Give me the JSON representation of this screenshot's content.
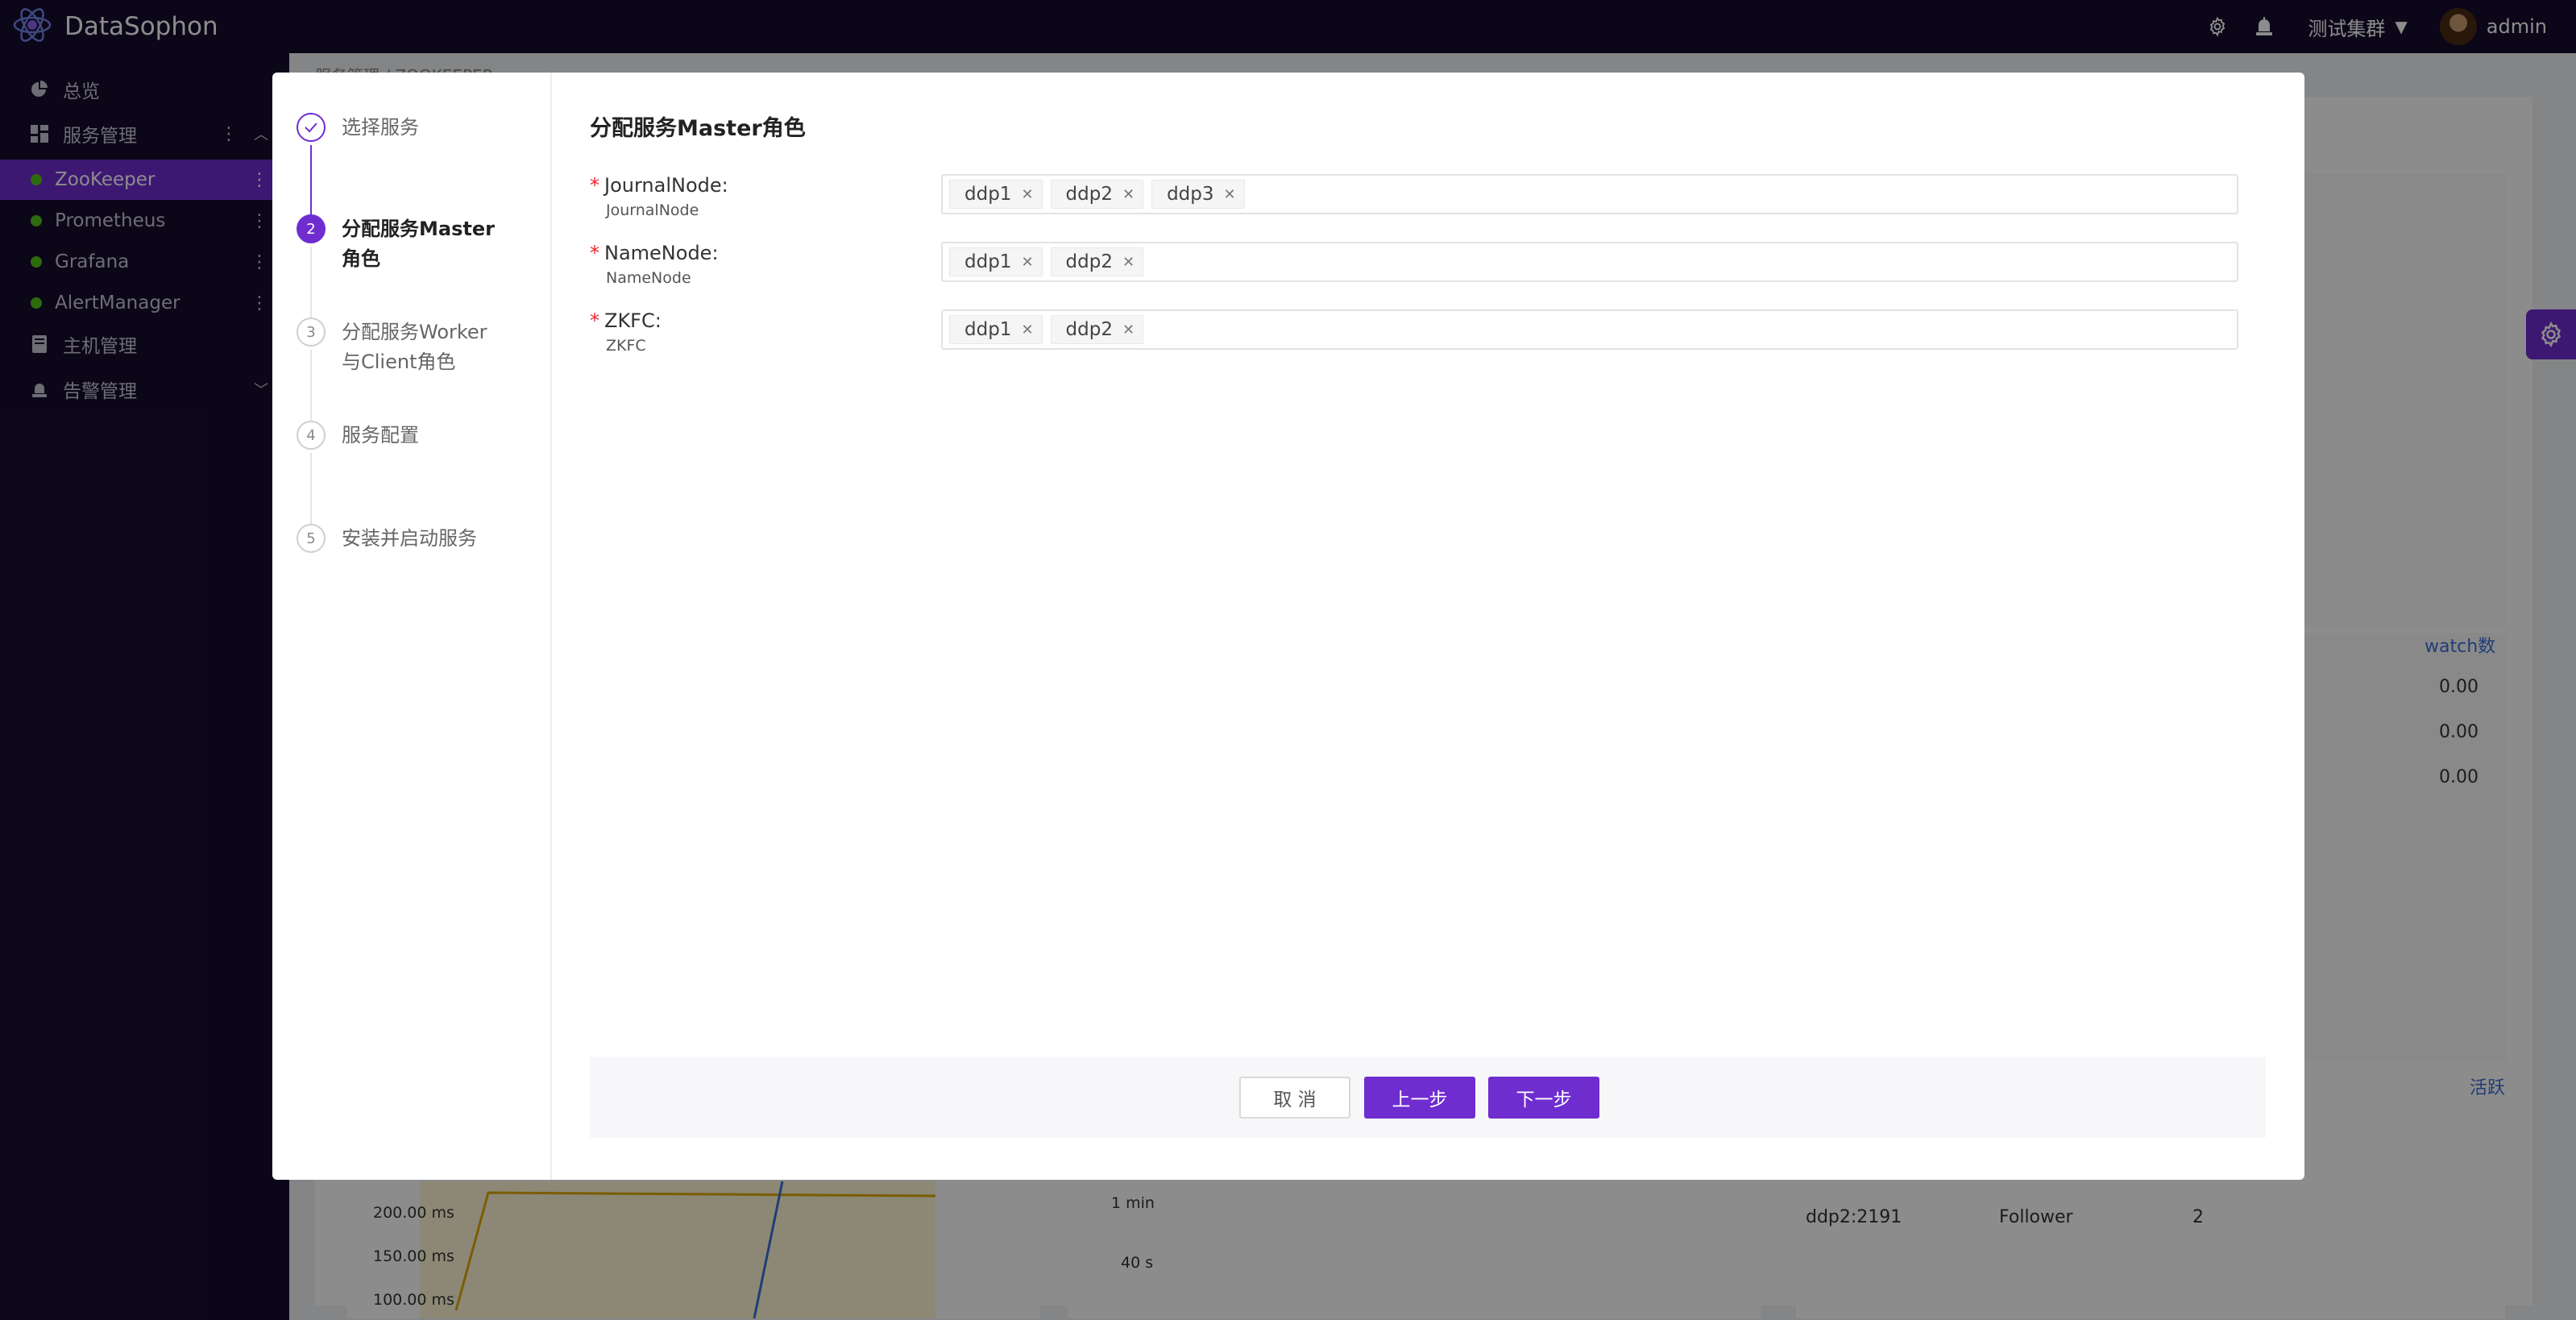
{
  "app": {
    "name": "DataSophon"
  },
  "topbar": {
    "cluster_name": "测试集群",
    "user": "admin",
    "icons": [
      "gear-icon",
      "bell-icon"
    ]
  },
  "sidebar": {
    "items": [
      {
        "label": "总览",
        "icon": "pie-chart-icon"
      },
      {
        "label": "服务管理",
        "icon": "dashboard-icon"
      },
      {
        "label": "ZooKeeper",
        "status_color": "#52c41a",
        "active": true
      },
      {
        "label": "Prometheus",
        "status_color": "#52c41a"
      },
      {
        "label": "Grafana",
        "status_color": "#52c41a"
      },
      {
        "label": "AlertManager",
        "status_color": "#52c41a"
      },
      {
        "label": "主机管理",
        "icon": "server-icon"
      },
      {
        "label": "告警管理",
        "icon": "alarm-icon"
      }
    ]
  },
  "background": {
    "breadcrumb": "服务管理 / ZOOKEEPER",
    "watch_header": "watch数",
    "watch_values": [
      "0.00",
      "0.00",
      "0.00"
    ],
    "active_header": "活跃",
    "latency_ticks": [
      "200.00 ms",
      "150.00 ms",
      "100.00 ms"
    ],
    "time_ticks": [
      "1 min",
      "40 s"
    ],
    "table_row": {
      "host": "ddp2:2191",
      "role": "Follower",
      "count": "2"
    }
  },
  "wizard": {
    "steps": [
      {
        "index": "1",
        "label": "选择服务",
        "status": "done"
      },
      {
        "index": "2",
        "label": "分配服务Master角色",
        "status": "current"
      },
      {
        "index": "3",
        "label": "分配服务Worker与Client角色",
        "status": "pending"
      },
      {
        "index": "4",
        "label": "服务配置",
        "status": "pending"
      },
      {
        "index": "5",
        "label": "安装并启动服务",
        "status": "pending"
      }
    ],
    "title": "分配服务Master角色",
    "fields": [
      {
        "label": "JournalNode:",
        "sublabel": "JournalNode",
        "tags": [
          "ddp1",
          "ddp2",
          "ddp3"
        ]
      },
      {
        "label": "NameNode:",
        "sublabel": "NameNode",
        "tags": [
          "ddp1",
          "ddp2"
        ]
      },
      {
        "label": "ZKFC:",
        "sublabel": "ZKFC",
        "tags": [
          "ddp1",
          "ddp2"
        ]
      }
    ],
    "buttons": {
      "cancel": "取 消",
      "prev": "上一步",
      "next": "下一步"
    }
  },
  "colors": {
    "primary": "#6f2dd0",
    "sidebar_bg": "#160c2e",
    "status_green": "#52c41a",
    "required": "#f5222d"
  }
}
